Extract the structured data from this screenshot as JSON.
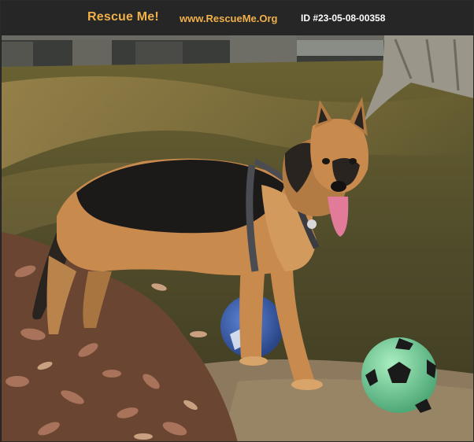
{
  "header": {
    "brand": "Rescue Me!",
    "site": "www.RescueMe.Org",
    "pet_id": "ID #23-05-08-00358"
  },
  "photo": {
    "subject_icons": [
      "dog-figure",
      "blue-ball",
      "green-soccer-ball",
      "tree-trunk",
      "fence"
    ],
    "colors": {
      "header_bg": "#262626",
      "brand": "#f0b04a",
      "grass": "#5a5a2c",
      "leaves": "#8a5a3a",
      "dog_tan": "#c98a4e",
      "dog_black": "#1c1a18",
      "ball_green": "#7fd6a0",
      "ball_blue": "#3d63b8"
    }
  }
}
